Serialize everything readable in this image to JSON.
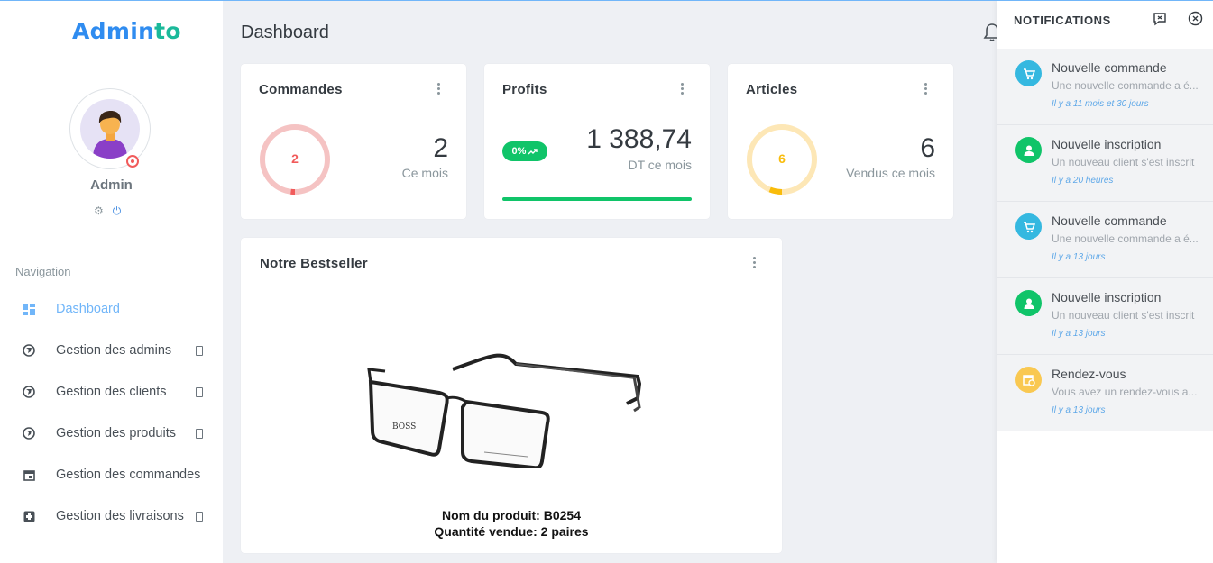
{
  "app": {
    "logo_part1": "Admin",
    "logo_part2": "to"
  },
  "user": {
    "name": "Admin"
  },
  "sidebar": {
    "nav_title": "Navigation",
    "items": [
      {
        "label": "Dashboard",
        "icon": "dashboard-grid-icon",
        "active": true
      },
      {
        "label": "Gestion des admins",
        "icon": "globe-icon",
        "has_submenu": true
      },
      {
        "label": "Gestion des clients",
        "icon": "globe-icon",
        "has_submenu": true
      },
      {
        "label": "Gestion des produits",
        "icon": "globe-icon",
        "has_submenu": true
      },
      {
        "label": "Gestion des commandes",
        "icon": "calendar-icon",
        "has_submenu": false
      },
      {
        "label": "Gestion des livraisons",
        "icon": "medical-cross-icon",
        "has_submenu": true
      }
    ]
  },
  "header": {
    "title": "Dashboard"
  },
  "stats": {
    "orders": {
      "title": "Commandes",
      "ring_value": "2",
      "value": "2",
      "caption": "Ce mois",
      "ring_color": "#f15b5b",
      "progress": 0.02
    },
    "profits": {
      "title": "Profits",
      "badge": "0%",
      "value": "1 388,74",
      "caption": "DT ce mois",
      "progress": 1.0,
      "color": "#10c469"
    },
    "articles": {
      "title": "Articles",
      "ring_value": "6",
      "value": "6",
      "caption": "Vendus ce mois",
      "ring_color": "#f9bc0b",
      "progress": 0.06
    }
  },
  "bestseller": {
    "title": "Notre Bestseller",
    "product_line": "Nom du produit: B0254",
    "quantity_line": "Quantité vendue: 2 paires",
    "brand_mark": "BOSS"
  },
  "notifications": {
    "title": "NOTIFICATIONS",
    "items": [
      {
        "title": "Nouvelle commande",
        "desc": "Une nouvelle commande a é...",
        "time": "Il y a 11 mois et 30 jours",
        "icon": "cart-icon",
        "color": "#35b8e0"
      },
      {
        "title": "Nouvelle inscription",
        "desc": "Un nouveau client s'est inscrit",
        "time": "Il y a 20 heures",
        "icon": "user-icon",
        "color": "#10c469"
      },
      {
        "title": "Nouvelle commande",
        "desc": "Une nouvelle commande a é...",
        "time": "Il y a 13 jours",
        "icon": "cart-icon",
        "color": "#35b8e0"
      },
      {
        "title": "Nouvelle inscription",
        "desc": "Un nouveau client s'est inscrit",
        "time": "Il y a 13 jours",
        "icon": "user-icon",
        "color": "#10c469"
      },
      {
        "title": "Rendez-vous",
        "desc": "Vous avez un rendez-vous a...",
        "time": "Il y a 13 jours",
        "icon": "calendar-clock-icon",
        "color": "#f9c851"
      }
    ]
  }
}
